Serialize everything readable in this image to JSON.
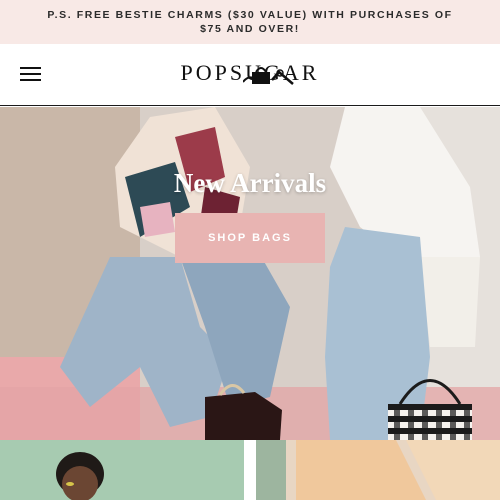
{
  "promo": {
    "text": "P.S. FREE BESTIE CHARMS ($30 VALUE) WITH PURCHASES OF $75 AND OVER!"
  },
  "header": {
    "logo": "POPSUGAR",
    "menu_icon": "hamburger-menu-icon",
    "cart_icon": "shopping-bag-icon"
  },
  "hero": {
    "heading": "New Arrivals",
    "cta_label": "SHOP BAGS"
  },
  "tiles": [
    {
      "name": "category-tile-left"
    },
    {
      "name": "category-tile-right"
    }
  ],
  "colors": {
    "promo_bg": "#f8e9e6",
    "cta_bg": "#e8b4b2",
    "tile_left_bg": "#a7cbb1",
    "tile_right_bg": "#e8d6c3"
  }
}
